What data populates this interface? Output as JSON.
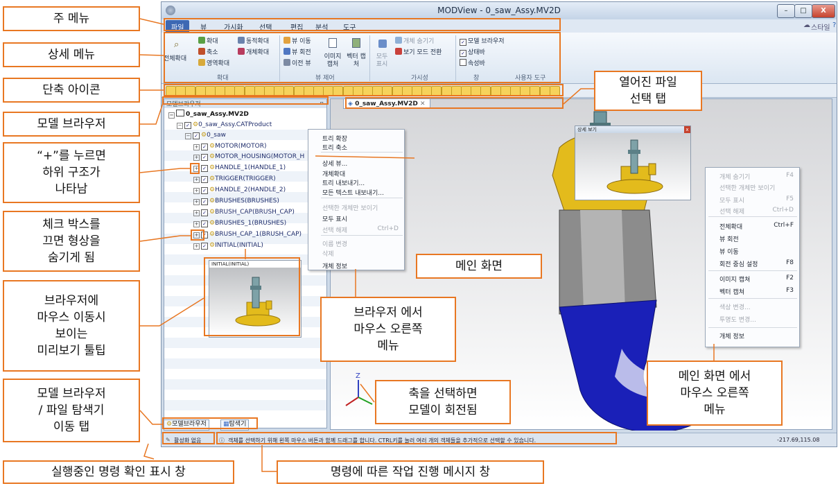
{
  "window": {
    "title": "MODView - 0_saw_Assy.MV2D",
    "buttons": [
      "–",
      "□",
      "X"
    ],
    "style_label": "스타일"
  },
  "menubar": {
    "items": [
      "파일",
      "뷰",
      "가시화",
      "선택",
      "편집",
      "분석",
      "도구"
    ]
  },
  "ribbon": {
    "zoom_group": {
      "full_zoom": "전체확대",
      "zoom_in": "확대",
      "zoom_out": "축소",
      "zoom_area": "영역확대",
      "dynamic_zoom": "동적확대",
      "object_zoom": "개체확대",
      "label": "확대"
    },
    "view_group": {
      "pan": "뷰 이동",
      "rotate": "뷰 회전",
      "prev_view": "이전 뷰",
      "image_capture": "이미지 캡처",
      "vector_capture": "벡터 캡처",
      "label": "뷰 제어"
    },
    "visibility_group": {
      "show_all": "모두 표시",
      "hide_object": "개체 숨기기",
      "toggle_view_mode": "보기 모드 전환",
      "label": "가시성"
    },
    "window_group": {
      "model_browser": "모델 브라우저",
      "statusbar": "상태바",
      "propertybar": "속성바",
      "label": "창",
      "custom_tools": "사용자 도구"
    }
  },
  "browser": {
    "header": "모델브라우저",
    "rows": [
      "0_saw_Assy.MV2D",
      "0_saw_Assy.CATProduct",
      "0_saw",
      "MOTOR(MOTOR)",
      "MOTOR_HOUSING(MOTOR_H",
      "HANDLE_1(HANDLE_1)",
      "TRIGGER(TRIGGER)",
      "HANDLE_2(HANDLE_2)",
      "BRUSHES(BRUSHES)",
      "BRUSH_CAP(BRUSH_CAP)",
      "BRUSHES_1(BRUSHES)",
      "BRUSH_CAP_1(BRUSH_CAP)",
      "INITIAL(INITIAL)"
    ],
    "preview_label": "INITIAL(INITIAL)",
    "tabs": [
      "모델브라우저",
      "탐색기"
    ]
  },
  "doc_tab": "0_saw_Assy.MV2D",
  "browser_context_menu": {
    "items": [
      {
        "label": "트리 확장",
        "enabled": true
      },
      {
        "label": "트리 축소",
        "enabled": true
      },
      {
        "label": "상세 뷰...",
        "enabled": true
      },
      {
        "label": "개체확대",
        "enabled": true
      },
      {
        "label": "트리 내보내기...",
        "enabled": true
      },
      {
        "label": "모든 텍스트 내보내기...",
        "enabled": true
      },
      {
        "label": "선택한 개체만 보이기",
        "enabled": false
      },
      {
        "label": "모두 표시",
        "enabled": true
      },
      {
        "label": "선택 해제",
        "enabled": false,
        "shortcut": "Ctrl+D"
      },
      {
        "label": "이름 변경",
        "enabled": false
      },
      {
        "label": "삭제",
        "enabled": false
      },
      {
        "label": "개체 정보",
        "enabled": true
      }
    ]
  },
  "detail_view_title": "상세 보기",
  "main_context_menu": {
    "items": [
      {
        "label": "개체 숨기기",
        "shortcut": "F4",
        "enabled": false
      },
      {
        "label": "선택한 개체만 보이기",
        "shortcut": "",
        "enabled": false
      },
      {
        "label": "모두 표시",
        "shortcut": "F5",
        "enabled": false
      },
      {
        "label": "선택 해제",
        "shortcut": "Ctrl+D",
        "enabled": false
      },
      {
        "label": "전체확대",
        "shortcut": "Ctrl+F",
        "enabled": true
      },
      {
        "label": "뷰 회전",
        "shortcut": "",
        "enabled": true
      },
      {
        "label": "뷰 이동",
        "shortcut": "",
        "enabled": true
      },
      {
        "label": "회전 중심 설정",
        "shortcut": "F8",
        "enabled": true
      },
      {
        "label": "이미지 캡쳐",
        "shortcut": "F2",
        "enabled": true
      },
      {
        "label": "벡터 캡쳐",
        "shortcut": "F3",
        "enabled": true
      },
      {
        "label": "색상 변경...",
        "shortcut": "",
        "enabled": false
      },
      {
        "label": "투명도 변경...",
        "shortcut": "",
        "enabled": false
      },
      {
        "label": "개체 정보",
        "shortcut": "",
        "enabled": true
      }
    ]
  },
  "statusbar": {
    "command": "활성화 없음",
    "message": "객체를 선택하기 위해 왼쪽 마우스 버튼과 함께 드래그를 합니다. CTRL키를 눌러 여러 개의 객체들을 추가적으로 선택할 수 있습니다.",
    "coords": "-217.69,115.08"
  },
  "axis_label": "Z",
  "annotations": {
    "main_menu": "주 메뉴",
    "detail_menu": "상세 메뉴",
    "shortcut_icons": "단축 아이콘",
    "model_browser": "모델 브라우저",
    "plus_hint": "“+”를 누르면\n하위 구조가\n나타남",
    "checkbox_hint": "체크 박스를\n끄면 형상을\n숨기게 됨",
    "preview_hint": "브라우저에\n마우스 이동시\n보이는\n미리보기 툴팁",
    "tab_hint": "모델 브라우저\n/ 파일 탐색기\n이동 탭",
    "running_cmd": "실행중인 명령 확인 표시 창",
    "open_file_tab": "열어진 파일\n선택 탭",
    "main_screen": "메인 화면",
    "browser_rclick": "브라우저 에서\n마우스 오른쪽\n메뉴",
    "axis_hint": "축을 선택하면\n모델이 회전됨",
    "main_rclick": "메인 화면 에서\n마우스 오른쪽\n메뉴",
    "progress_msg": "명령에 따른 작업 진행 메시지 창"
  },
  "colors": {
    "annotation": "#e87722",
    "model_yellow": "#e3bb1c",
    "model_blue": "#1a20b8",
    "model_gray": "#8c8c8c"
  }
}
